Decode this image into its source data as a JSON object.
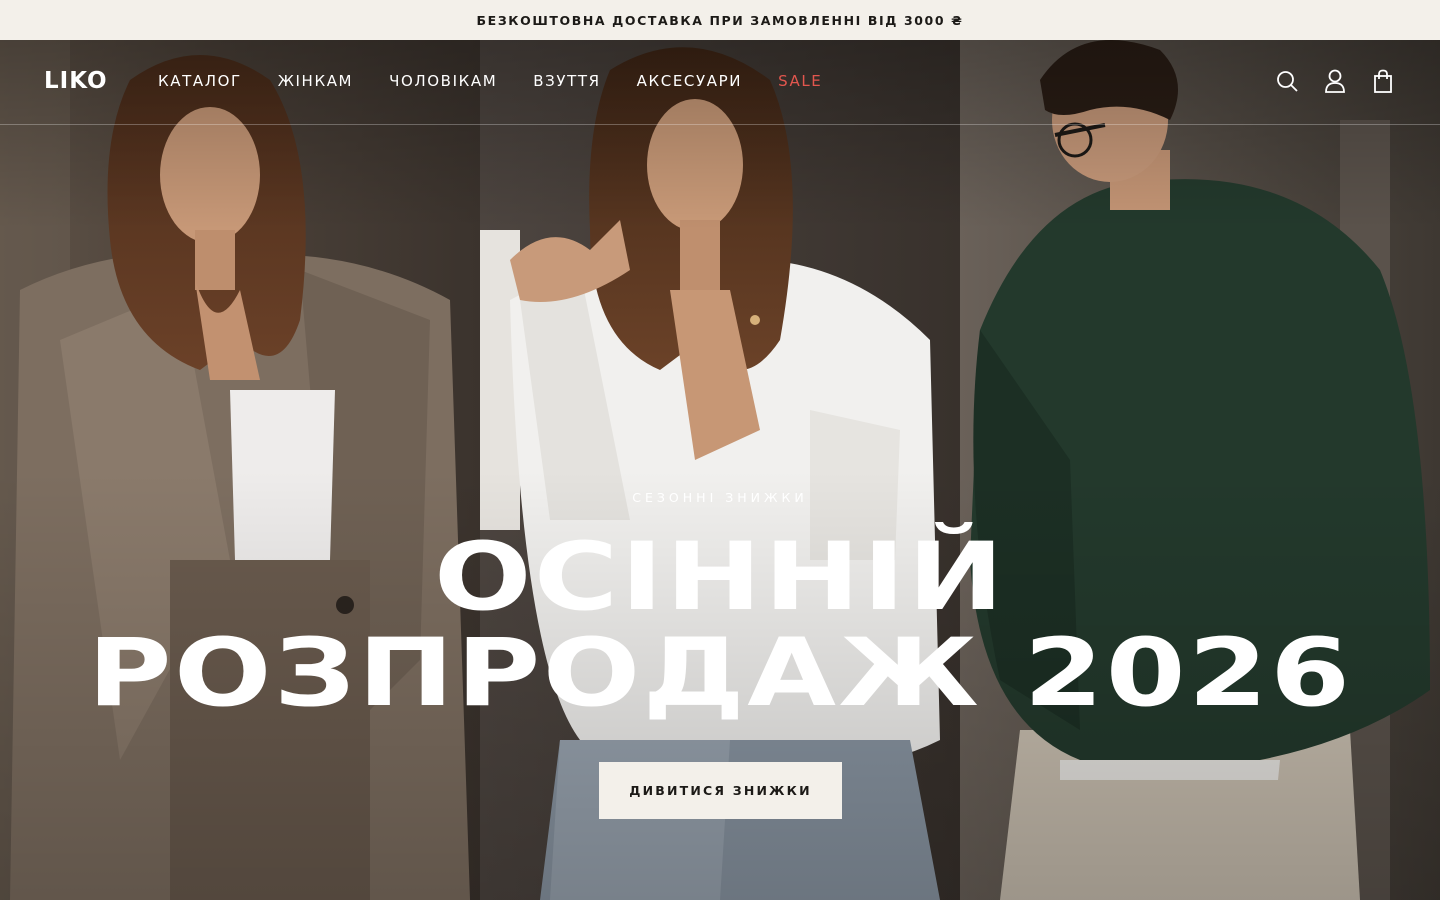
{
  "announcement": {
    "text": "БЕЗКОШТОВНА ДОСТАВКА ПРИ ЗАМОВЛЕННІ ВІД 3000 ₴"
  },
  "header": {
    "logo": "LIKO",
    "nav": [
      {
        "label": "КАТАЛОГ"
      },
      {
        "label": "ЖІНКАМ"
      },
      {
        "label": "ЧОЛОВІКАМ"
      },
      {
        "label": "ВЗУТТЯ"
      },
      {
        "label": "АКСЕСУАРИ"
      },
      {
        "label": "SALE"
      }
    ],
    "icons": [
      "search-icon",
      "account-icon",
      "bag-icon"
    ]
  },
  "hero": {
    "kicker": "СЕЗОННІ ЗНИЖКИ",
    "title_line1": "ОСІННІЙ",
    "title_line2": "РОЗПРОДАЖ 2026",
    "cta_label": "ДИВИТИСЯ ЗНИЖКИ"
  },
  "colors": {
    "announcement_bg": "#f3f0ea",
    "sale": "#e2564e",
    "cta_bg": "#f3f0ea",
    "text_dark": "#1c1a17"
  }
}
